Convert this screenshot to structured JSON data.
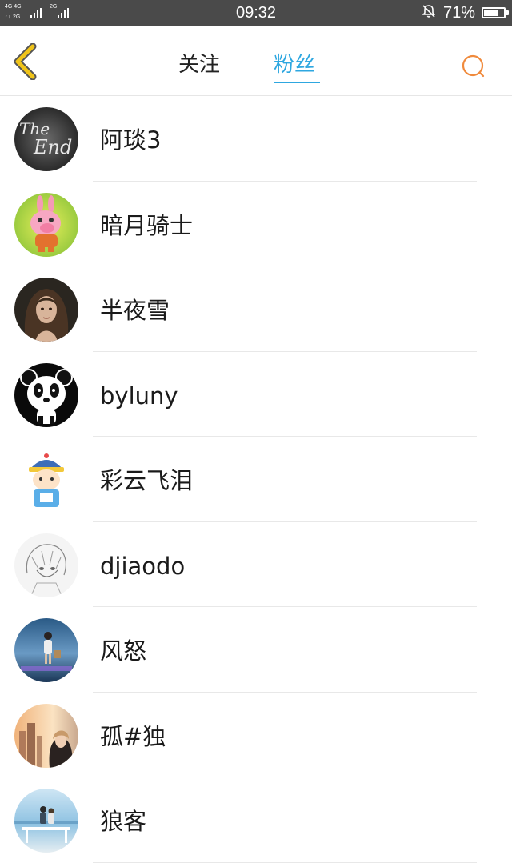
{
  "status_bar": {
    "network_left": "4G 4G",
    "network_right": "2G",
    "time": "09:32",
    "battery_percent": "71%",
    "battery_level": 0.71
  },
  "nav": {
    "tab_follow": "关注",
    "tab_fans": "粉丝",
    "active_tab": "粉丝",
    "accent_color": "#2ea7e0",
    "back_icon_color": "#f0c419",
    "search_icon_color": "#f08a3c"
  },
  "fans": [
    {
      "name": "阿琰3",
      "avatar": "the-end-avatar"
    },
    {
      "name": "暗月骑士",
      "avatar": "pink-bunny-avatar"
    },
    {
      "name": "半夜雪",
      "avatar": "woman-portrait-avatar"
    },
    {
      "name": "byluny",
      "avatar": "panda-avatar"
    },
    {
      "name": "彩云飞泪",
      "avatar": "cartoon-boy-avatar"
    },
    {
      "name": "djiaodo",
      "avatar": "anime-sketch-avatar"
    },
    {
      "name": "风怒",
      "avatar": "girl-seaside-avatar"
    },
    {
      "name": "孤#独",
      "avatar": "girl-city-avatar"
    },
    {
      "name": "狼客",
      "avatar": "couple-beach-avatar"
    }
  ]
}
